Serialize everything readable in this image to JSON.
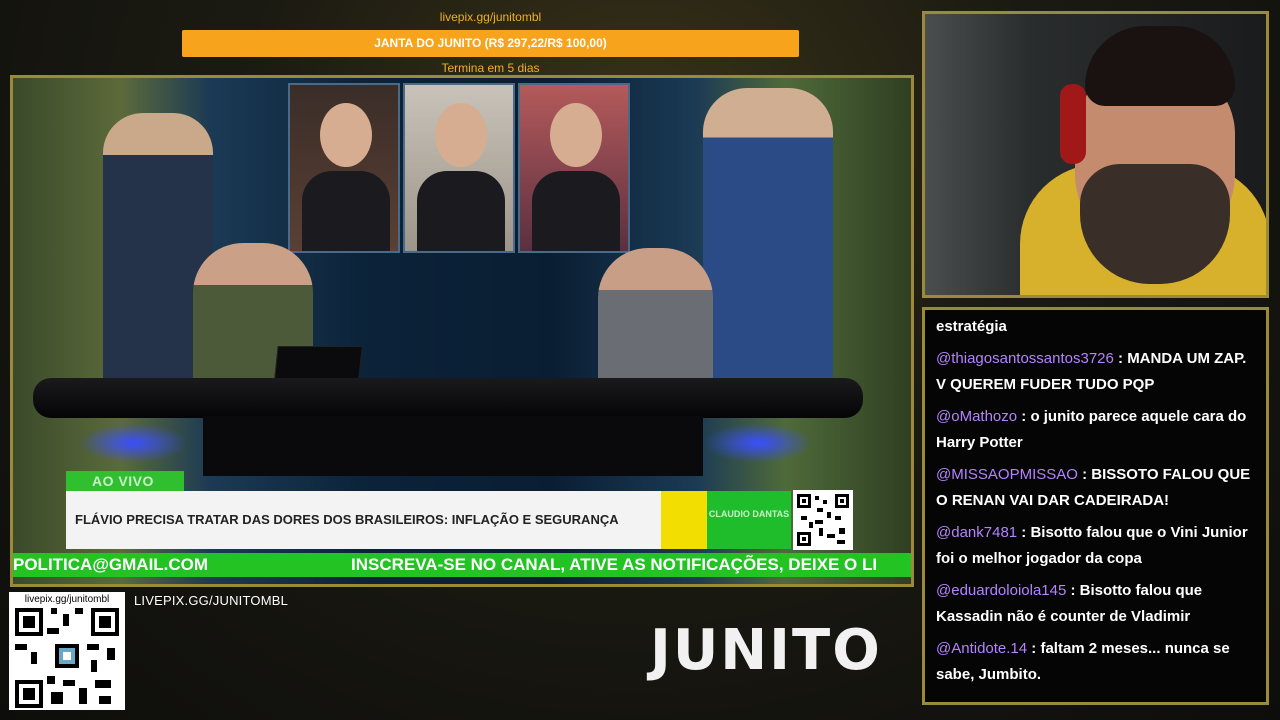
{
  "goal": {
    "url": "livepix.gg/junitombl",
    "label": "JANTA DO JUNITO (R$ 297,22/R$ 100,00)",
    "progress_fraction": 1.0,
    "ends_text": "Termina em 5 dias",
    "color": "#f7a31c"
  },
  "broadcast": {
    "live_label": "AO VIVO",
    "headline": "FLÁVIO PRECISA TRATAR DAS DORES DOS BRASILEIROS: INFLAÇÃO E SEGURANÇA",
    "brand": "CLAUDIO DANTAS",
    "ticker_left": "POLITICA@GMAIL.COM",
    "ticker_right": "INSCREVA-SE NO CANAL, ATIVE AS NOTIFICAÇÕES, DEIXE O LI"
  },
  "chat": {
    "partial_first": "estratégia",
    "messages": [
      {
        "user": "@thiagosantossantos3726",
        "text": " : MANDA UM ZAP. V QUEREM FUDER TUDO PQP"
      },
      {
        "user": "@oMathozo",
        "text": " : o junito parece aquele cara do Harry Potter"
      },
      {
        "user": "@MISSAOPMISSAO",
        "text": " : BISSOTO FALOU QUE O RENAN VAI DAR CADEIRADA!"
      },
      {
        "user": "@dank7481",
        "text": " : Bisotto falou que o Vini Junior foi o melhor jogador da copa"
      },
      {
        "user": "@eduardoloiola145",
        "text": " : Bisotto falou que Kassadin não é counter de Vladimir"
      },
      {
        "user": "@Antidote.14",
        "text": " : faltam 2 meses... nunca se sabe, Jumbito."
      }
    ],
    "user_color": "#b483ff"
  },
  "footer": {
    "qr_label": "livepix.gg/junitombl",
    "url_text": "LIVEPIX.GG/JUNITOMBL",
    "logo_text": "JUNITO"
  },
  "colors": {
    "frame_border": "#9b8a3a",
    "ticker_green": "#24c324"
  }
}
